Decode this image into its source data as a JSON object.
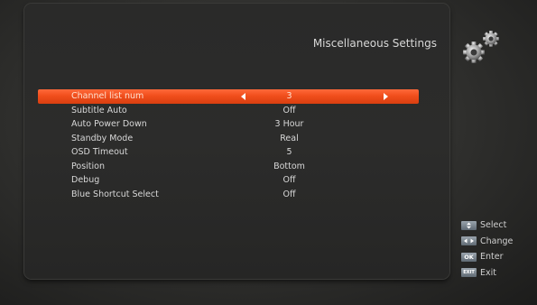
{
  "screen": {
    "title": "Miscellaneous Settings"
  },
  "settings": [
    {
      "label": "Channel list num",
      "value": "3",
      "selected": true
    },
    {
      "label": "Subtitle Auto",
      "value": "Off"
    },
    {
      "label": "Auto Power Down",
      "value": "3 Hour"
    },
    {
      "label": "Standby Mode",
      "value": "Real"
    },
    {
      "label": "OSD Timeout",
      "value": "5"
    },
    {
      "label": "Position",
      "value": "Bottom"
    },
    {
      "label": "Debug",
      "value": "Off"
    },
    {
      "label": "Blue Shortcut Select",
      "value": "Off"
    }
  ],
  "help": [
    {
      "key": "",
      "icon": "up-down-key-icon",
      "label": "Select"
    },
    {
      "key": "",
      "icon": "left-right-key-icon",
      "label": "Change"
    },
    {
      "key": "OK",
      "icon": "ok-key-icon",
      "label": "Enter"
    },
    {
      "key": "EXIT",
      "icon": "exit-key-icon",
      "label": "Exit"
    }
  ],
  "colors": {
    "highlight": "#f04e1c",
    "background": "#2c2c2b",
    "text": "#d8d8d8"
  }
}
